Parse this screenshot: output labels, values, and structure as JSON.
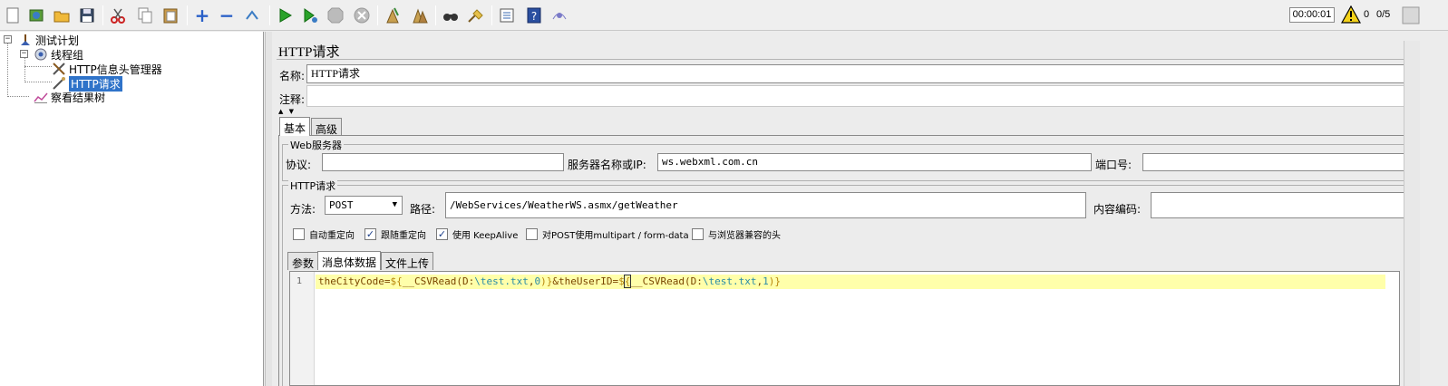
{
  "toolbar": {
    "buttons": [
      {
        "name": "new-icon"
      },
      {
        "name": "templates-icon"
      },
      {
        "name": "open-icon"
      },
      {
        "name": "save-icon"
      },
      {
        "name": "cut-icon"
      },
      {
        "name": "copy-icon"
      },
      {
        "name": "paste-icon"
      },
      {
        "name": "expand-icon"
      },
      {
        "name": "collapse-icon"
      },
      {
        "name": "toggle-icon"
      },
      {
        "name": "start-icon"
      },
      {
        "name": "start-no-pauses-icon"
      },
      {
        "name": "stop-icon"
      },
      {
        "name": "shutdown-icon"
      },
      {
        "name": "clear-icon"
      },
      {
        "name": "clear-all-icon"
      },
      {
        "name": "search-icon"
      },
      {
        "name": "reset-search-icon"
      },
      {
        "name": "function-helper-icon"
      },
      {
        "name": "help-icon"
      },
      {
        "name": "remote-icon"
      }
    ],
    "timer": "00:00:01",
    "warning_count": "0",
    "thread_count": "0/5"
  },
  "tree": {
    "test_plan": "测试计划",
    "thread_group": "线程组",
    "header_manager": "HTTP信息头管理器",
    "http_request": "HTTP请求",
    "result_tree": "察看结果树"
  },
  "panel": {
    "title": "HTTP请求",
    "name_label": "名称:",
    "name_value": "HTTP请求",
    "comment_label": "注释:",
    "comment_value": "",
    "collapse_arrows": "▲ ▼"
  },
  "tabs": {
    "basic": "基本",
    "advanced": "高级"
  },
  "web_server": {
    "legend": "Web服务器",
    "protocol_label": "协议:",
    "protocol_value": "",
    "server_label": "服务器名称或IP:",
    "server_value": "ws.webxml.com.cn",
    "port_label": "端口号:",
    "port_value": ""
  },
  "http_request": {
    "legend": "HTTP请求",
    "method_label": "方法:",
    "method_value": "POST",
    "path_label": "路径:",
    "path_value": "/WebServices/WeatherWS.asmx/getWeather",
    "encoding_label": "内容编码:",
    "encoding_value": ""
  },
  "options": [
    {
      "label": "自动重定向",
      "checked": false
    },
    {
      "label": "跟随重定向",
      "checked": true
    },
    {
      "label": "使用 KeepAlive",
      "checked": true
    },
    {
      "label": "对POST使用multipart / form-data",
      "checked": false
    },
    {
      "label": "与浏览器兼容的头",
      "checked": false
    }
  ],
  "body_tabs": {
    "params": "参数",
    "body_data": "消息体数据",
    "file_upload": "文件上传"
  },
  "editor": {
    "line_number": "1",
    "tokens": {
      "t1": "theCityCode=",
      "t2": "${",
      "t3": "__CSVRead(D:",
      "t4": "\\test.txt",
      "t5": ",",
      "t6": "0",
      "t7": ")}",
      "t8": "&theUserID=",
      "t9": "$",
      "t10": "{",
      "t11": "__CSVRead(D:",
      "t12": "\\test.txt",
      "t13": ",",
      "t14": "1",
      "t15": ")}"
    }
  }
}
